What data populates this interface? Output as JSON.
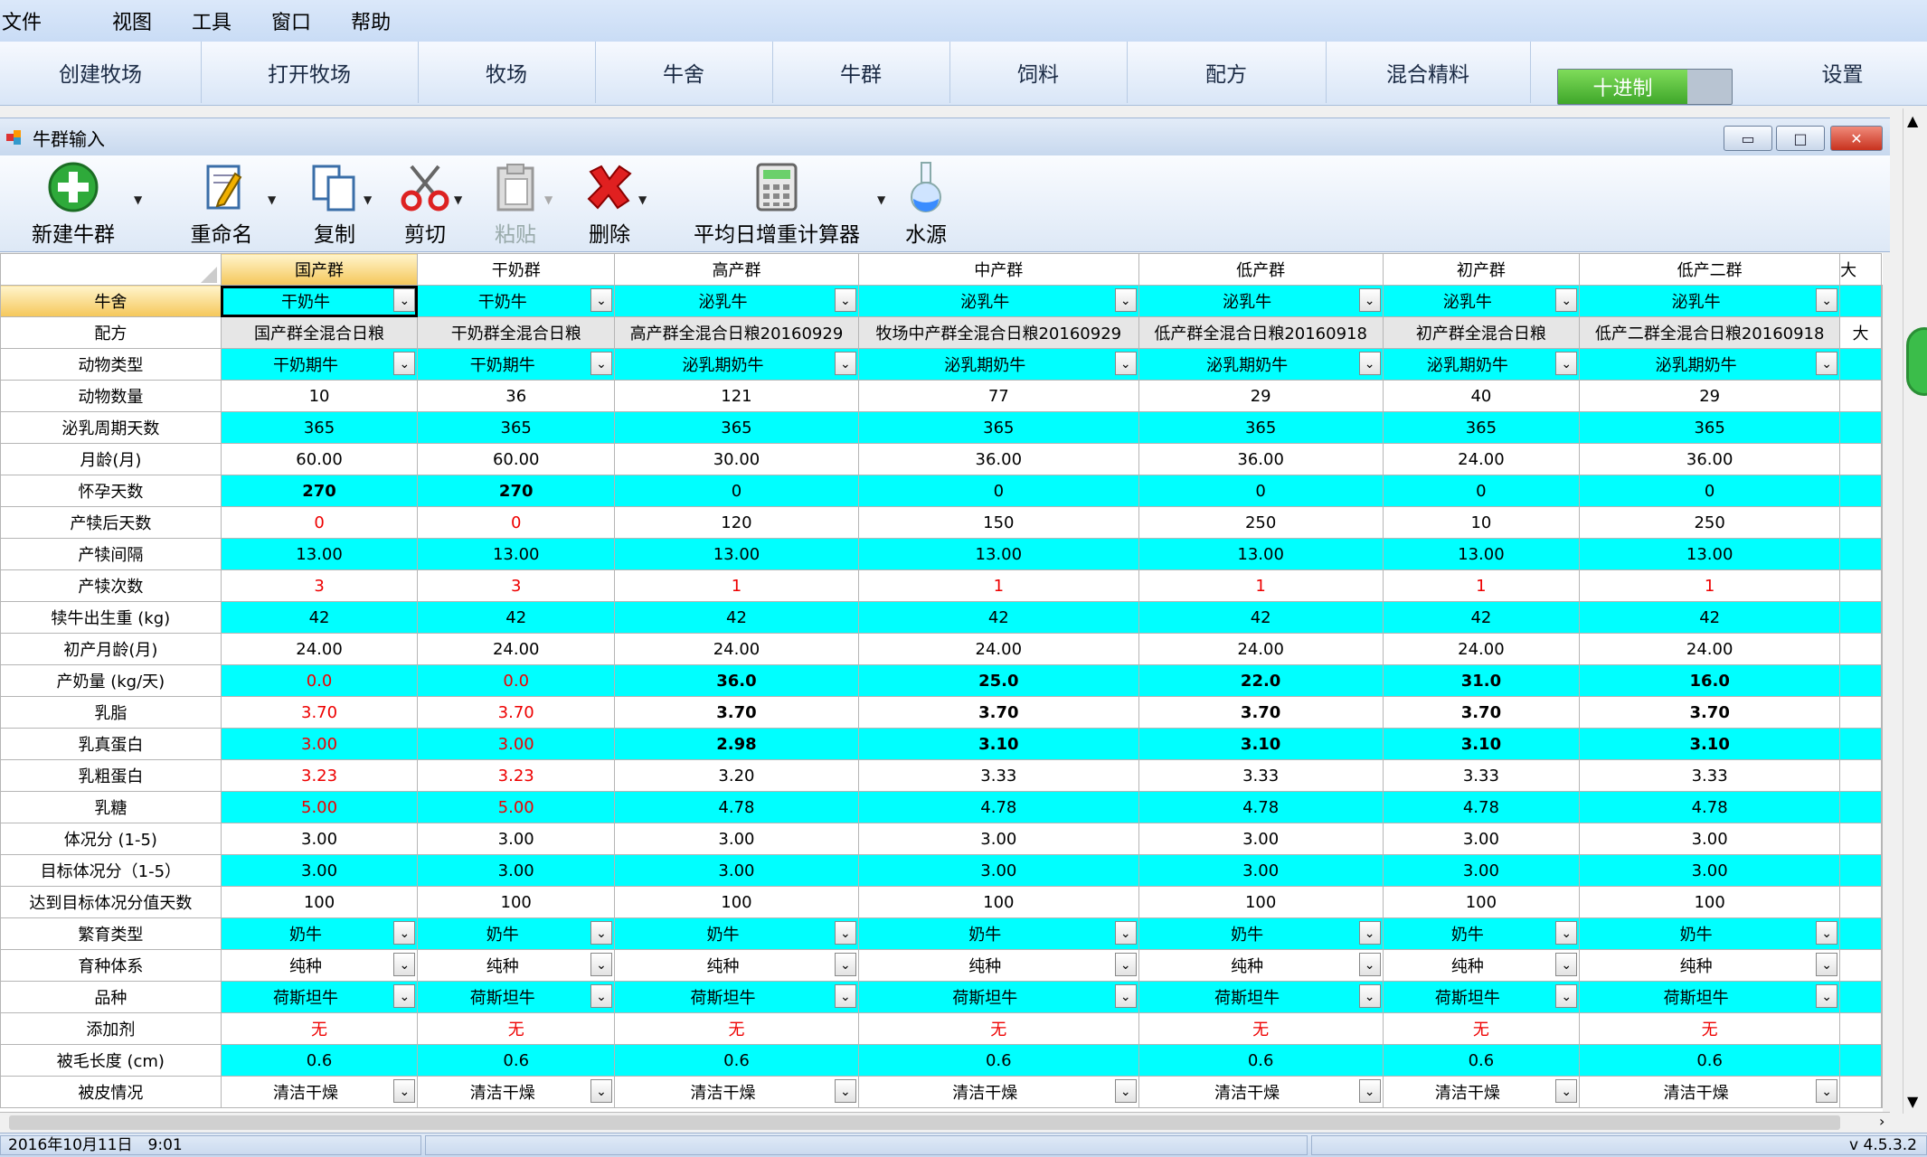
{
  "menu": [
    "文件",
    "视图",
    "工具",
    "窗口",
    "帮助"
  ],
  "nav": [
    "创建牧场",
    "打开牧场",
    "牧场",
    "牛舍",
    "牛群",
    "饲料",
    "配方",
    "混合精料",
    "十进制",
    "设置"
  ],
  "window": {
    "title": "牛群输入"
  },
  "toolbar": [
    "新建牛群",
    "重命名",
    "复制",
    "剪切",
    "粘贴",
    "删除",
    "平均日增重计算器",
    "水源"
  ],
  "columns": [
    "国产群",
    "干奶群",
    "高产群",
    "中产群",
    "低产群",
    "初产群",
    "低产二群",
    "大"
  ],
  "rows": [
    {
      "label": "牛舍",
      "type": "dd",
      "cyan": true,
      "values": [
        "干奶牛",
        "干奶牛",
        "泌乳牛",
        "泌乳牛",
        "泌乳牛",
        "泌乳牛",
        "泌乳牛",
        ""
      ]
    },
    {
      "label": "配方",
      "type": "gray",
      "cyan": false,
      "values": [
        "国产群全混合日粮",
        "干奶群全混合日粮",
        "高产群全混合日粮20160929",
        "牧场中产群全混合日粮20160929",
        "低产群全混合日粮20160918",
        "初产群全混合日粮",
        "低产二群全混合日粮20160918",
        "大"
      ]
    },
    {
      "label": "动物类型",
      "type": "dd",
      "cyan": true,
      "values": [
        "干奶期牛",
        "干奶期牛",
        "泌乳期奶牛",
        "泌乳期奶牛",
        "泌乳期奶牛",
        "泌乳期奶牛",
        "泌乳期奶牛",
        ""
      ]
    },
    {
      "label": "动物数量",
      "cyan": false,
      "values": [
        "10",
        "36",
        "121",
        "77",
        "29",
        "40",
        "29",
        ""
      ]
    },
    {
      "label": "泌乳周期天数",
      "cyan": true,
      "values": [
        "365",
        "365",
        "365",
        "365",
        "365",
        "365",
        "365",
        ""
      ]
    },
    {
      "label": "月龄(月)",
      "cyan": false,
      "values": [
        "60.00",
        "60.00",
        "30.00",
        "36.00",
        "36.00",
        "24.00",
        "36.00",
        ""
      ]
    },
    {
      "label": "怀孕天数",
      "cyan": true,
      "bold": [
        true,
        true,
        false,
        false,
        false,
        false,
        false,
        false
      ],
      "values": [
        "270",
        "270",
        "0",
        "0",
        "0",
        "0",
        "0",
        ""
      ]
    },
    {
      "label": "产犊后天数",
      "cyan": false,
      "red": [
        true,
        true,
        false,
        false,
        false,
        false,
        false,
        false
      ],
      "values": [
        "0",
        "0",
        "120",
        "150",
        "250",
        "10",
        "250",
        ""
      ]
    },
    {
      "label": "产犊间隔",
      "cyan": true,
      "values": [
        "13.00",
        "13.00",
        "13.00",
        "13.00",
        "13.00",
        "13.00",
        "13.00",
        ""
      ]
    },
    {
      "label": "产犊次数",
      "cyan": false,
      "red": [
        true,
        true,
        true,
        true,
        true,
        true,
        true,
        false
      ],
      "values": [
        "3",
        "3",
        "1",
        "1",
        "1",
        "1",
        "1",
        ""
      ]
    },
    {
      "label": "犊牛出生重 (kg)",
      "cyan": true,
      "values": [
        "42",
        "42",
        "42",
        "42",
        "42",
        "42",
        "42",
        ""
      ]
    },
    {
      "label": "初产月龄(月)",
      "cyan": false,
      "values": [
        "24.00",
        "24.00",
        "24.00",
        "24.00",
        "24.00",
        "24.00",
        "24.00",
        ""
      ]
    },
    {
      "label": "产奶量 (kg/天)",
      "cyan": true,
      "red": [
        true,
        true,
        false,
        false,
        false,
        false,
        false,
        false
      ],
      "bold": [
        false,
        false,
        true,
        true,
        true,
        true,
        true,
        false
      ],
      "values": [
        "0.0",
        "0.0",
        "36.0",
        "25.0",
        "22.0",
        "31.0",
        "16.0",
        ""
      ]
    },
    {
      "label": "乳脂",
      "cyan": false,
      "red": [
        true,
        true,
        false,
        false,
        false,
        false,
        false,
        false
      ],
      "bold": [
        false,
        false,
        true,
        true,
        true,
        true,
        true,
        false
      ],
      "values": [
        "3.70",
        "3.70",
        "3.70",
        "3.70",
        "3.70",
        "3.70",
        "3.70",
        ""
      ]
    },
    {
      "label": "乳真蛋白",
      "cyan": true,
      "red": [
        true,
        true,
        false,
        false,
        false,
        false,
        false,
        false
      ],
      "bold": [
        false,
        false,
        true,
        true,
        true,
        true,
        true,
        false
      ],
      "values": [
        "3.00",
        "3.00",
        "2.98",
        "3.10",
        "3.10",
        "3.10",
        "3.10",
        ""
      ]
    },
    {
      "label": "乳粗蛋白",
      "cyan": false,
      "red": [
        true,
        true,
        false,
        false,
        false,
        false,
        false,
        false
      ],
      "values": [
        "3.23",
        "3.23",
        "3.20",
        "3.33",
        "3.33",
        "3.33",
        "3.33",
        ""
      ]
    },
    {
      "label": "乳糖",
      "cyan": true,
      "red": [
        true,
        true,
        false,
        false,
        false,
        false,
        false,
        false
      ],
      "values": [
        "5.00",
        "5.00",
        "4.78",
        "4.78",
        "4.78",
        "4.78",
        "4.78",
        ""
      ]
    },
    {
      "label": "体况分 (1-5)",
      "cyan": false,
      "values": [
        "3.00",
        "3.00",
        "3.00",
        "3.00",
        "3.00",
        "3.00",
        "3.00",
        ""
      ]
    },
    {
      "label": "目标体况分（1-5）",
      "cyan": true,
      "values": [
        "3.00",
        "3.00",
        "3.00",
        "3.00",
        "3.00",
        "3.00",
        "3.00",
        ""
      ]
    },
    {
      "label": "达到目标体况分值天数",
      "cyan": false,
      "values": [
        "100",
        "100",
        "100",
        "100",
        "100",
        "100",
        "100",
        ""
      ]
    },
    {
      "label": "繁育类型",
      "type": "dd",
      "cyan": true,
      "values": [
        "奶牛",
        "奶牛",
        "奶牛",
        "奶牛",
        "奶牛",
        "奶牛",
        "奶牛",
        ""
      ]
    },
    {
      "label": "育种体系",
      "type": "dd",
      "cyan": false,
      "values": [
        "纯种",
        "纯种",
        "纯种",
        "纯种",
        "纯种",
        "纯种",
        "纯种",
        ""
      ]
    },
    {
      "label": "品种",
      "type": "dd",
      "cyan": true,
      "values": [
        "荷斯坦牛",
        "荷斯坦牛",
        "荷斯坦牛",
        "荷斯坦牛",
        "荷斯坦牛",
        "荷斯坦牛",
        "荷斯坦牛",
        ""
      ]
    },
    {
      "label": "添加剂",
      "cyan": false,
      "red": [
        true,
        true,
        true,
        true,
        true,
        true,
        true,
        false
      ],
      "values": [
        "无",
        "无",
        "无",
        "无",
        "无",
        "无",
        "无",
        ""
      ]
    },
    {
      "label": "被毛长度 (cm)",
      "cyan": true,
      "values": [
        "0.6",
        "0.6",
        "0.6",
        "0.6",
        "0.6",
        "0.6",
        "0.6",
        ""
      ]
    },
    {
      "label": "被皮情况",
      "type": "dd",
      "cyan": false,
      "values": [
        "清洁干燥",
        "清洁干燥",
        "清洁干燥",
        "清洁干燥",
        "清洁干燥",
        "清洁干燥",
        "清洁干燥",
        ""
      ]
    }
  ],
  "status": {
    "datetime": "2016年10月11日　9:01",
    "version": "v 4.5.3.2"
  }
}
